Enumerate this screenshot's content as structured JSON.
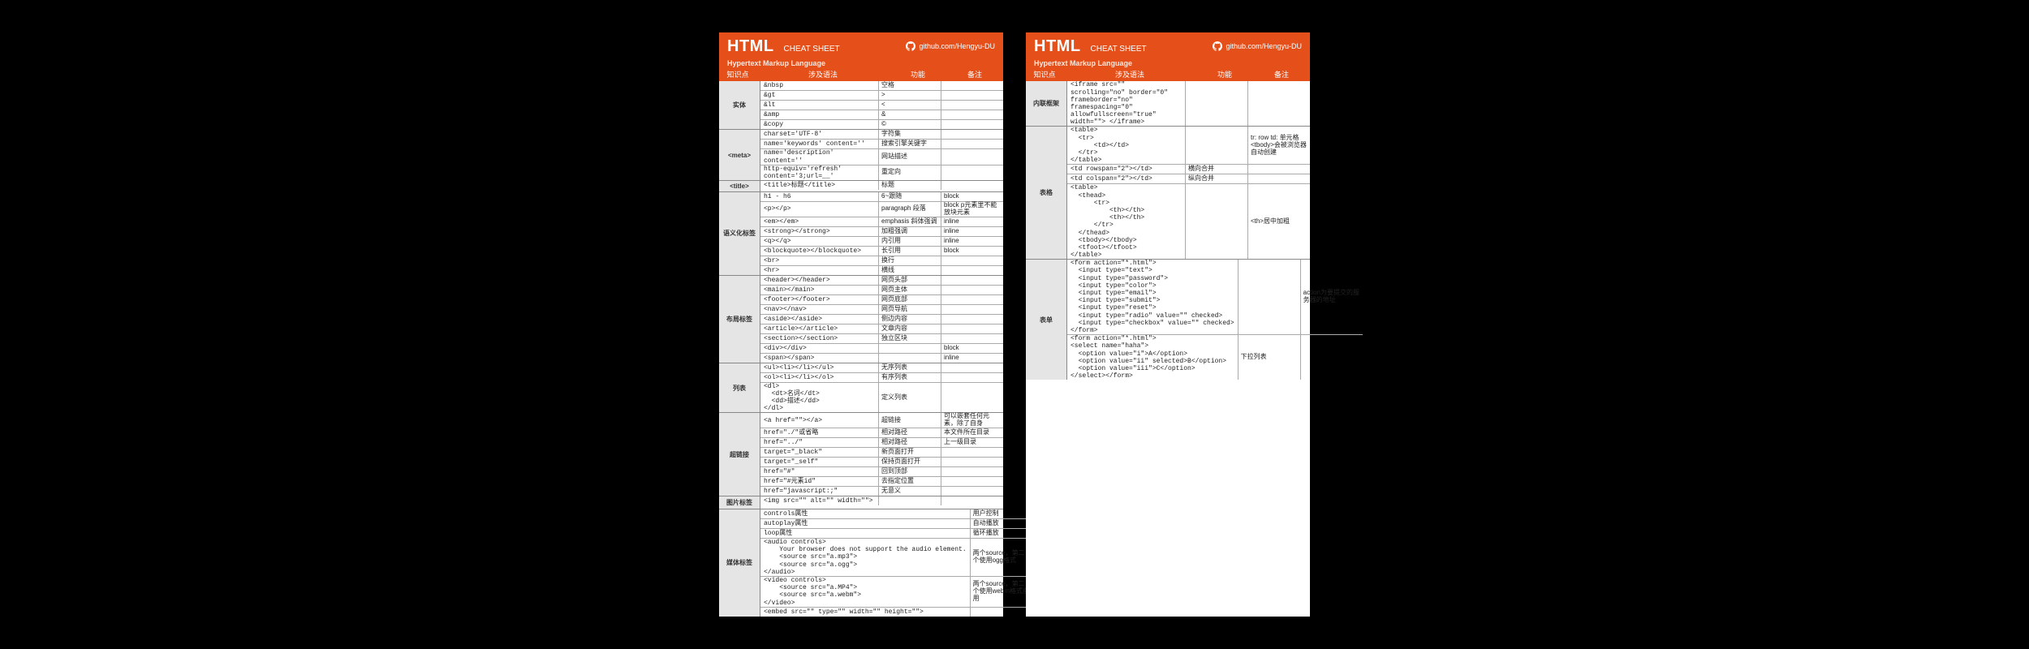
{
  "header": {
    "logo": "HTML",
    "cheat": "CHEAT SHEET",
    "github": "github.com/Hengyu-DU",
    "subtitle": "Hypertext Markup Language",
    "cols": {
      "c1": "知识点",
      "c2": "涉及语法",
      "c3": "功能",
      "c4": "备注"
    }
  },
  "left": [
    {
      "label": "实体",
      "rows": [
        {
          "s": "&nbsp",
          "f": "空格"
        },
        {
          "s": "&gt",
          "f": ">"
        },
        {
          "s": "&lt",
          "f": "<"
        },
        {
          "s": "&amp",
          "f": "&"
        },
        {
          "s": "&copy",
          "f": "©"
        }
      ]
    },
    {
      "label": "<meta>",
      "rows": [
        {
          "s": "charset='UTF-8'",
          "f": "字符集"
        },
        {
          "s": "name='keywords' content=''",
          "f": "搜索引擎关键字"
        },
        {
          "s": "name='description' content=''",
          "f": "网站描述"
        },
        {
          "s": "http-equiv='refresh' content='3;url=__'",
          "f": "重定向"
        }
      ]
    },
    {
      "label": "<title>",
      "rows": [
        {
          "s": "<title>标题</title>",
          "f": "标题"
        }
      ]
    },
    {
      "label": "语义化标签",
      "rows": [
        {
          "s": "h1 - h6",
          "f": "6~跟随",
          "n": "block"
        },
        {
          "s": "<p></p>",
          "f": "paragraph 段落",
          "n": "block p元素里不能放块元素"
        },
        {
          "s": "<em></em>",
          "f": "emphasis 斜体强调",
          "n": "inline"
        },
        {
          "s": "<strong></strong>",
          "f": "加粗强调",
          "n": "inline"
        },
        {
          "s": "<q></q>",
          "f": "内引用",
          "n": "inline"
        },
        {
          "s": "<blockquote></blockquote>",
          "f": "长引用",
          "n": "block"
        },
        {
          "s": "<br>",
          "f": "换行"
        },
        {
          "s": "<hr>",
          "f": "横线"
        }
      ]
    },
    {
      "label": "布局标签",
      "rows": [
        {
          "s": "<header></header>",
          "f": "网页头部"
        },
        {
          "s": "<main></main>",
          "f": "网页主体"
        },
        {
          "s": "<footer></footer>",
          "f": "网页底部"
        },
        {
          "s": "<nav></nav>",
          "f": "网页导航"
        },
        {
          "s": "<aside></aside>",
          "f": "侧边内容"
        },
        {
          "s": "<article></article>",
          "f": "文章内容"
        },
        {
          "s": "<section></section>",
          "f": "独立区块"
        },
        {
          "s": "<div></div>",
          "f": "",
          "n": "block"
        },
        {
          "s": "<span></span>",
          "f": "",
          "n": "inline"
        }
      ]
    },
    {
      "label": "列表",
      "rows": [
        {
          "s": "<ul><li></li></ul>",
          "f": "无序列表"
        },
        {
          "s": "<ol><li></li></ol>",
          "f": "有序列表"
        },
        {
          "s": "<dl>\n  <dt>名词</dt>\n  <dd>描述</dd>\n</dl>",
          "f": "定义列表"
        }
      ]
    },
    {
      "label": "超链接",
      "rows": [
        {
          "s": "<a href=\"\"></a>",
          "f": "超链接",
          "n": "可以嵌套任何元素，除了自身"
        },
        {
          "s": "href=\"./\"或省略",
          "f": "相对路径",
          "n": "本文件所在目录"
        },
        {
          "s": "href=\"../\"",
          "f": "相对路径",
          "n": "上一级目录"
        },
        {
          "s": "target=\"_black\"",
          "f": "新页面打开"
        },
        {
          "s": "target=\"_self\"",
          "f": "保持页面打开"
        },
        {
          "s": "href=\"#\"",
          "f": "回到顶部"
        },
        {
          "s": "href=\"#元素id\"",
          "f": "去指定位置"
        },
        {
          "s": "href=\"javascript:;\"",
          "f": "无意义"
        }
      ]
    },
    {
      "label": "图片标签",
      "rows": [
        {
          "s": "<img src=\"\" alt=\"\" width=\"\">",
          "f": ""
        }
      ]
    },
    {
      "label": "媒体标签",
      "sub": [
        {
          "rows": [
            {
              "s": "controls属性",
              "f": "用户控制"
            },
            {
              "s": "autoplay属性",
              "f": "自动播放"
            },
            {
              "s": "loop属性",
              "f": "循环播放"
            }
          ]
        },
        {
          "mergedFn": "两个source，第二个使用ogg格式",
          "lines": [
            "<audio controls>",
            "    Your browser does not support the audio element.",
            "    <source src=\"a.mp3\">",
            "    <source src=\"a.ogg\">",
            "</audio>"
          ]
        },
        {
          "mergedFn": "两个source，第二个使用webm格式备用",
          "lines": [
            "<video controls>",
            "    <source src=\"a.MP4\">",
            "    <source src=\"a.webm\">",
            "</video>"
          ]
        },
        {
          "rows": [
            {
              "s": "<embed src=\"\" type=\"\" width=\"\" height=\"\">",
              "f": ""
            }
          ]
        }
      ]
    }
  ],
  "right": [
    {
      "label": "内联框架",
      "rows": [
        {
          "s": "<iframe src=\"\" scrolling=\"no\" border=\"0\" frameborder=\"no\" framespacing=\"0\" allowfullscreen=\"true\" width=\"\"> </iframe>",
          "f": ""
        }
      ]
    },
    {
      "label": "表格",
      "sub": [
        {
          "mergedNote": "tr: row\ntd: 单元格\n<tbody>会被浏览器自动创建",
          "lines": [
            "<table>",
            "  <tr>",
            "      <td></td>",
            "  </tr>",
            "</table>"
          ]
        },
        {
          "rows": [
            {
              "s": "<td rowspan=\"2\"></td>",
              "f": "横向合并"
            },
            {
              "s": "<td colspan=\"2\"></td>",
              "f": "纵向合并"
            }
          ]
        },
        {
          "mergedNote": "<th>居中加粗",
          "lines": [
            "<table>",
            "  <thead>",
            "      <tr>",
            "          <th></th>",
            "          <th></th>",
            "      </tr>",
            "  </thead>",
            "  <tbody></tbody>",
            "  <tfoot></tfoot>",
            "</table>"
          ]
        }
      ]
    },
    {
      "label": "表单",
      "sub": [
        {
          "mergedNote": "action为要提交的服务器的地址",
          "lines": [
            "<form action=\"*.html\">",
            "  <input type=\"text\">",
            "  <input type=\"password\">",
            "  <input type=\"color\">",
            "  <input type=\"email\">",
            "  <input type=\"submit\">",
            "  <input type=\"reset\">",
            "  <input type=\"radio\" value=\"\" checked>",
            "  <input type=\"checkbox\" value=\"\" checked>",
            "</form>"
          ]
        },
        {
          "mergedFn": "下拉列表",
          "lines": [
            "<form action=\"*.html\">",
            "<select name=\"haha\">",
            "  <option value=\"i\">A</option>",
            "  <option value=\"ii\" selected>B</option>",
            "  <option value=\"iii\">C</option>",
            "</select></form>"
          ]
        }
      ]
    }
  ]
}
